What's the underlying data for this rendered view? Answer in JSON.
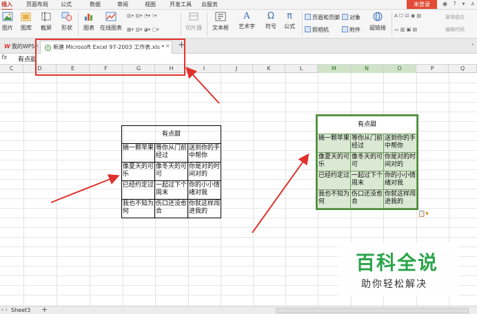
{
  "menu": {
    "items": [
      "插入",
      "页面布局",
      "公式",
      "数据",
      "审阅",
      "视图",
      "开发工具",
      "云服务"
    ],
    "active_index": 0,
    "login_label": "未登录"
  },
  "ribbon": {
    "picture_label": "图片",
    "gallery_label": "图库",
    "screenshot_label": "截屏",
    "shape_label": "形状",
    "chart_label": "图表",
    "online_chart_label": "在线图表",
    "slicer_label": "切片器",
    "textbox_label": "文本框",
    "wordart_label": "艺术字",
    "symbol_label": "符号",
    "formula_label": "公式",
    "header_footer_label": "页眉和页脚",
    "object_label": "对象",
    "camera_label": "照相机",
    "attachment_label": "附件",
    "hyperlink_label": "超链接",
    "form_label": "窗体组合",
    "edit_code_label": "编辑代码"
  },
  "tabs": {
    "wps_tab": "我的WPS",
    "doc_tab": "新建 Microsoft Excel 97-2003 工作表.xls *"
  },
  "formula_bar": {
    "fx": "fx",
    "value": "有点甜"
  },
  "columns": {
    "headers": [
      "C",
      "D",
      "E",
      "F",
      "G",
      "H",
      "I",
      "J",
      "K",
      "L",
      "M",
      "N",
      "O",
      "P",
      "Q"
    ],
    "selected": [
      "M",
      "N",
      "O"
    ]
  },
  "table": {
    "title": "有点甜",
    "rows": [
      [
        "摘一颗苹果",
        "等你从门前经过",
        "送到你的手中帮你"
      ],
      [
        "像夏天的可乐",
        "像冬天的可可",
        "你是对的时间对的"
      ],
      [
        "已经约定过",
        "一起过下个周末",
        "你的小小情绪对我"
      ],
      [
        "我也不知为何",
        "伤口还没愈合",
        "你就这样闯进我的"
      ]
    ]
  },
  "watermark": {
    "title": "百科全说",
    "subtitle": "助你轻松解决"
  },
  "status": {
    "sheet_name": "Sheet3"
  },
  "colors": {
    "accent": "#c0392b",
    "highlight_box": "#e0322c",
    "selection_fill": "#dbe9d4",
    "selection_border": "#4d8f3a",
    "watermark_green": "#2aa44a"
  }
}
